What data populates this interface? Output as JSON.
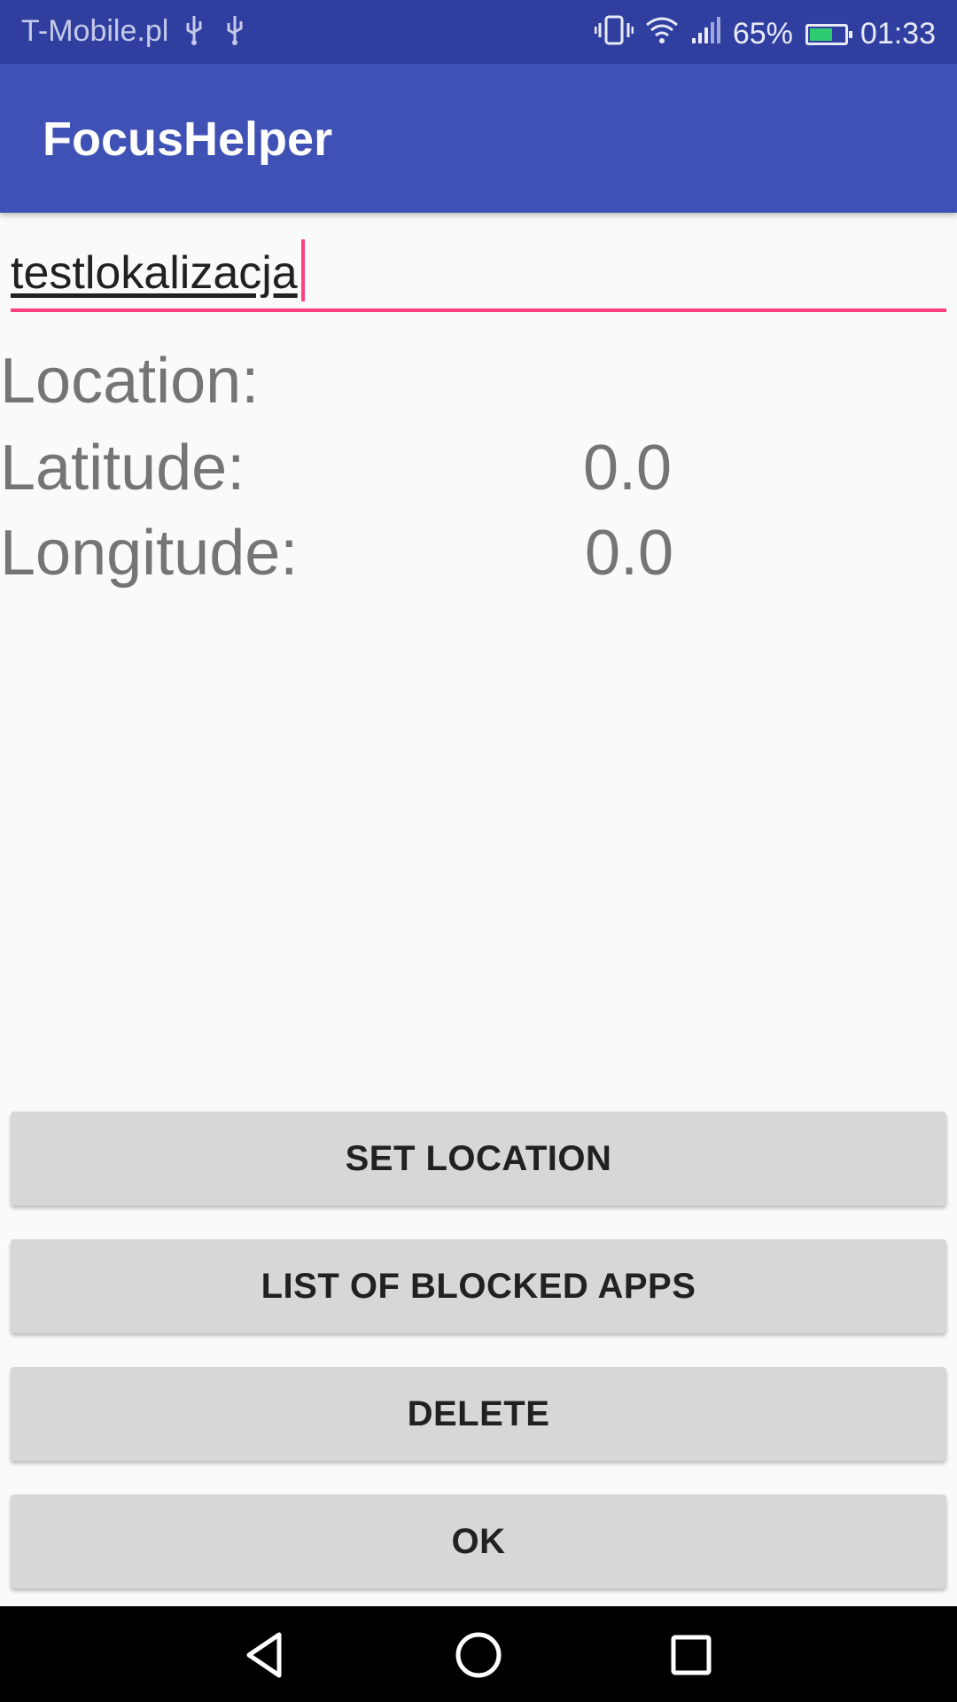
{
  "status_bar": {
    "carrier": "T-Mobile.pl",
    "left_icons": [
      "usb-icon",
      "usb-icon"
    ],
    "right_icons": [
      "vibrate-icon",
      "wifi-icon",
      "signal-icon",
      "battery-icon"
    ],
    "battery_percent": "65%",
    "battery_level": 0.65,
    "time": "01:33"
  },
  "app_bar": {
    "title": "FocusHelper"
  },
  "name_field": {
    "value": "testlokalizacja"
  },
  "location": {
    "location_label": "Location:",
    "latitude_label": "Latitude:",
    "latitude_value": "0.0",
    "longitude_label": "Longitude:",
    "longitude_value": "0.0"
  },
  "buttons": {
    "set_location": "SET LOCATION",
    "list_blocked_apps": "LIST OF BLOCKED APPS",
    "delete": "DELETE",
    "ok": "OK"
  },
  "nav_bar": {
    "icons": [
      "back-icon",
      "home-icon",
      "recents-icon"
    ]
  },
  "colors": {
    "primary": "#3F51B5",
    "primary_dark": "#303F9F",
    "accent": "#FF4081",
    "button": "#D6D7D7"
  }
}
